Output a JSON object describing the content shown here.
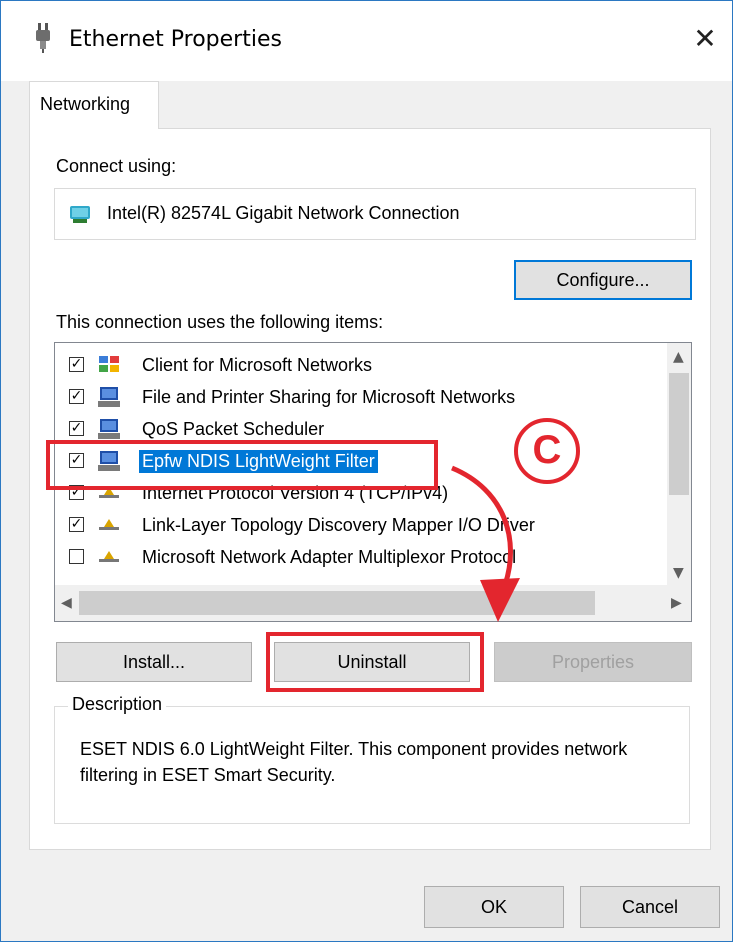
{
  "window": {
    "title": "Ethernet Properties",
    "close_symbol": "✕",
    "icon": "network-plug-icon"
  },
  "tabs": [
    {
      "label": "Networking",
      "selected": true
    }
  ],
  "connect_using": {
    "label": "Connect using:",
    "adapter": "Intel(R) 82574L Gigabit Network Connection",
    "adapter_icon": "network-adapter-icon"
  },
  "buttons": {
    "configure": "Configure...",
    "install": "Install...",
    "uninstall": "Uninstall",
    "properties": "Properties",
    "ok": "OK",
    "cancel": "Cancel"
  },
  "items_label": "This connection uses the following items:",
  "items": [
    {
      "label": "Client for Microsoft Networks",
      "checked": true,
      "icon": "network-client-icon"
    },
    {
      "label": "File and Printer Sharing for Microsoft Networks",
      "checked": true,
      "icon": "computer-service-icon"
    },
    {
      "label": "QoS Packet Scheduler",
      "checked": true,
      "icon": "computer-service-icon"
    },
    {
      "label": "Epfw NDIS LightWeight Filter",
      "checked": true,
      "selected": true,
      "icon": "computer-service-icon"
    },
    {
      "label": "Internet Protocol Version 4 (TCP/IPv4)",
      "checked": true,
      "icon": "protocol-icon"
    },
    {
      "label": "Link-Layer Topology Discovery Mapper I/O Driver",
      "checked": true,
      "icon": "protocol-icon"
    },
    {
      "label": "Microsoft Network Adapter Multiplexor Protocol",
      "checked": false,
      "icon": "protocol-icon"
    }
  ],
  "description": {
    "title": "Description",
    "text": "ESET NDIS 6.0 LightWeight Filter. This component provides network filtering in ESET Smart Security."
  },
  "annotation": {
    "marker": "C",
    "color": "#e3262e"
  },
  "colors": {
    "selection": "#0078d7",
    "default_button_border": "#0078d7",
    "window_border": "#2b78c2"
  }
}
